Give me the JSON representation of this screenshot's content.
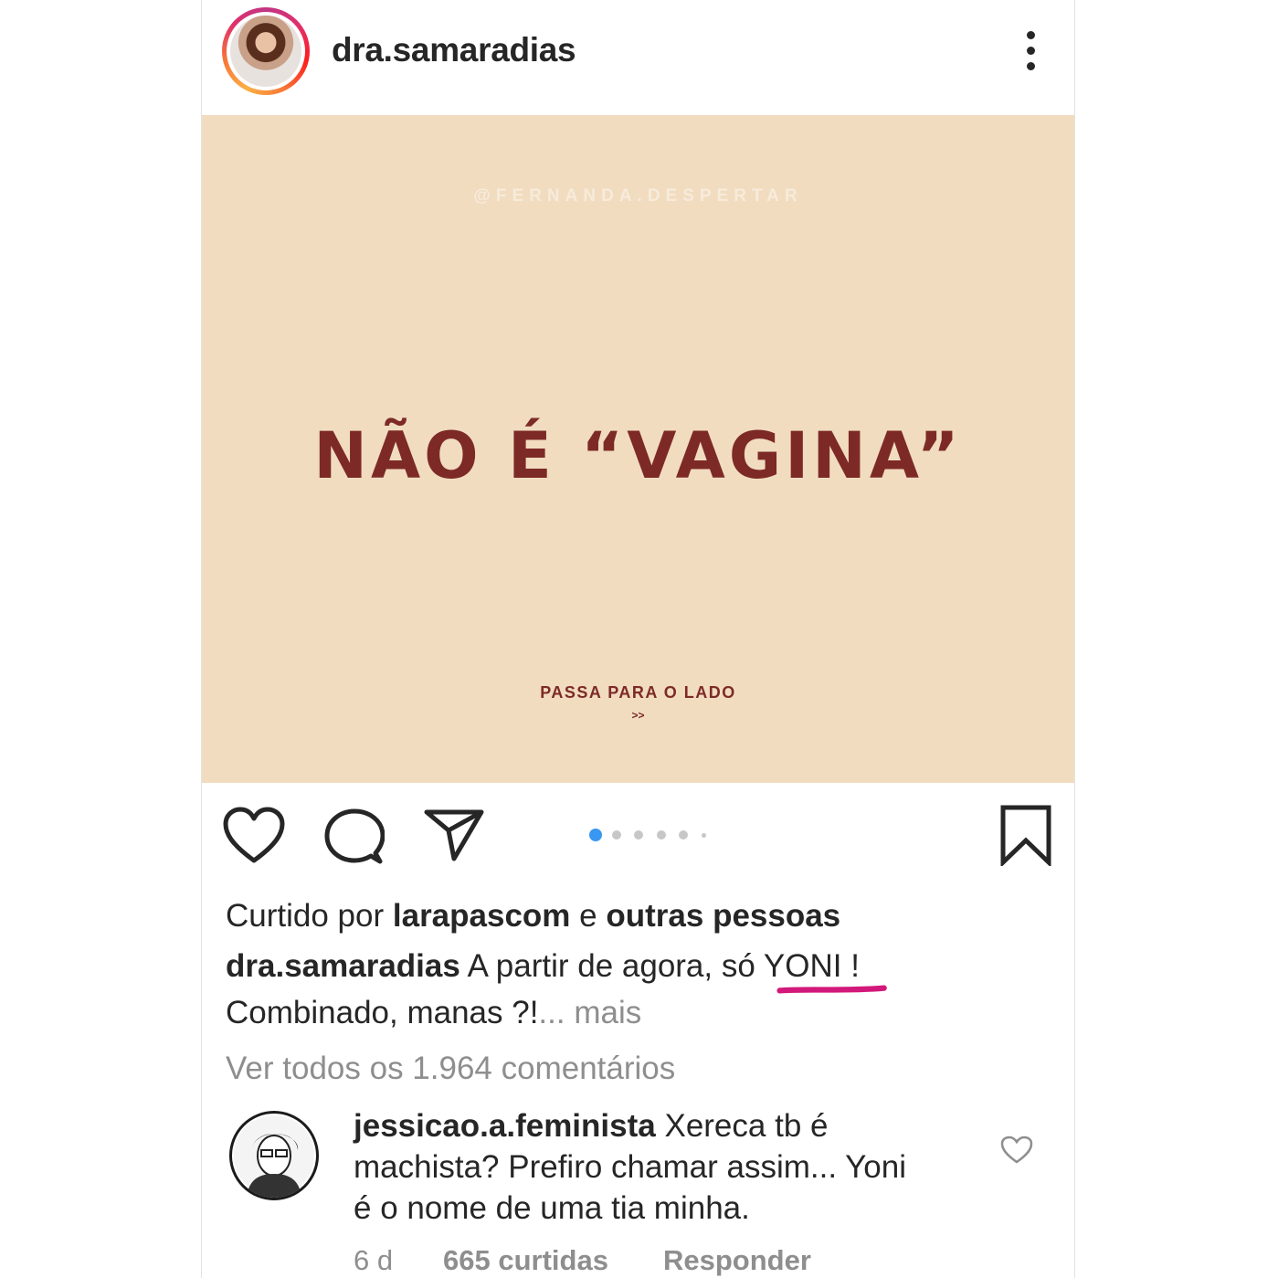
{
  "header": {
    "username": "dra.samaradias"
  },
  "post_image": {
    "watermark": "@FERNANDA.DESPERTAR",
    "headline": "NÃO É “VAGINA”",
    "swipe_hint": "PASSA PARA O LADO",
    "swipe_arrows": ">>",
    "background_color": "#f1dcc0",
    "text_color": "#7d2a26"
  },
  "carousel": {
    "total": 6,
    "active_index": 0,
    "active_color": "#3897f0"
  },
  "likes": {
    "prefix": "Curtido por",
    "user": "larapascom",
    "conjunction": "e",
    "others": "outras pessoas"
  },
  "caption": {
    "author": "dra.samaradias",
    "text_line1": "A partir de agora,",
    "highlight": "só YONI !",
    "text_line2": "Combinado, manas ?!",
    "more": "... mais",
    "highlight_mark_color": "#d2187a"
  },
  "view_comments": "Ver todos os 1.964 comentários",
  "comment": {
    "author": "jessicao.a.feminista",
    "line1": "Xereca tb é",
    "line2": "machista? Prefiro chamar assim... Yoni",
    "line3": "é o nome de uma tia minha.",
    "age": "6 d",
    "likes": "665 curtidas",
    "reply": "Responder"
  },
  "icons": {
    "like": "heart-icon",
    "comment": "comment-bubble-icon",
    "share": "paper-plane-icon",
    "save": "bookmark-icon",
    "options": "more-vertical-icon",
    "comment_like": "small-heart-icon"
  }
}
